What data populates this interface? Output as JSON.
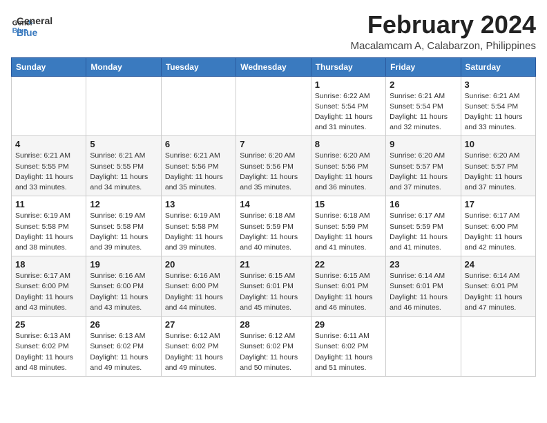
{
  "logo": {
    "line1": "General",
    "line2": "Blue"
  },
  "title": {
    "month_year": "February 2024",
    "location": "Macalamcam A, Calabarzon, Philippines"
  },
  "days_of_week": [
    "Sunday",
    "Monday",
    "Tuesday",
    "Wednesday",
    "Thursday",
    "Friday",
    "Saturday"
  ],
  "weeks": [
    [
      {
        "day": "",
        "info": ""
      },
      {
        "day": "",
        "info": ""
      },
      {
        "day": "",
        "info": ""
      },
      {
        "day": "",
        "info": ""
      },
      {
        "day": "1",
        "info": "Sunrise: 6:22 AM\nSunset: 5:54 PM\nDaylight: 11 hours\nand 31 minutes."
      },
      {
        "day": "2",
        "info": "Sunrise: 6:21 AM\nSunset: 5:54 PM\nDaylight: 11 hours\nand 32 minutes."
      },
      {
        "day": "3",
        "info": "Sunrise: 6:21 AM\nSunset: 5:54 PM\nDaylight: 11 hours\nand 33 minutes."
      }
    ],
    [
      {
        "day": "4",
        "info": "Sunrise: 6:21 AM\nSunset: 5:55 PM\nDaylight: 11 hours\nand 33 minutes."
      },
      {
        "day": "5",
        "info": "Sunrise: 6:21 AM\nSunset: 5:55 PM\nDaylight: 11 hours\nand 34 minutes."
      },
      {
        "day": "6",
        "info": "Sunrise: 6:21 AM\nSunset: 5:56 PM\nDaylight: 11 hours\nand 35 minutes."
      },
      {
        "day": "7",
        "info": "Sunrise: 6:20 AM\nSunset: 5:56 PM\nDaylight: 11 hours\nand 35 minutes."
      },
      {
        "day": "8",
        "info": "Sunrise: 6:20 AM\nSunset: 5:56 PM\nDaylight: 11 hours\nand 36 minutes."
      },
      {
        "day": "9",
        "info": "Sunrise: 6:20 AM\nSunset: 5:57 PM\nDaylight: 11 hours\nand 37 minutes."
      },
      {
        "day": "10",
        "info": "Sunrise: 6:20 AM\nSunset: 5:57 PM\nDaylight: 11 hours\nand 37 minutes."
      }
    ],
    [
      {
        "day": "11",
        "info": "Sunrise: 6:19 AM\nSunset: 5:58 PM\nDaylight: 11 hours\nand 38 minutes."
      },
      {
        "day": "12",
        "info": "Sunrise: 6:19 AM\nSunset: 5:58 PM\nDaylight: 11 hours\nand 39 minutes."
      },
      {
        "day": "13",
        "info": "Sunrise: 6:19 AM\nSunset: 5:58 PM\nDaylight: 11 hours\nand 39 minutes."
      },
      {
        "day": "14",
        "info": "Sunrise: 6:18 AM\nSunset: 5:59 PM\nDaylight: 11 hours\nand 40 minutes."
      },
      {
        "day": "15",
        "info": "Sunrise: 6:18 AM\nSunset: 5:59 PM\nDaylight: 11 hours\nand 41 minutes."
      },
      {
        "day": "16",
        "info": "Sunrise: 6:17 AM\nSunset: 5:59 PM\nDaylight: 11 hours\nand 41 minutes."
      },
      {
        "day": "17",
        "info": "Sunrise: 6:17 AM\nSunset: 6:00 PM\nDaylight: 11 hours\nand 42 minutes."
      }
    ],
    [
      {
        "day": "18",
        "info": "Sunrise: 6:17 AM\nSunset: 6:00 PM\nDaylight: 11 hours\nand 43 minutes."
      },
      {
        "day": "19",
        "info": "Sunrise: 6:16 AM\nSunset: 6:00 PM\nDaylight: 11 hours\nand 43 minutes."
      },
      {
        "day": "20",
        "info": "Sunrise: 6:16 AM\nSunset: 6:00 PM\nDaylight: 11 hours\nand 44 minutes."
      },
      {
        "day": "21",
        "info": "Sunrise: 6:15 AM\nSunset: 6:01 PM\nDaylight: 11 hours\nand 45 minutes."
      },
      {
        "day": "22",
        "info": "Sunrise: 6:15 AM\nSunset: 6:01 PM\nDaylight: 11 hours\nand 46 minutes."
      },
      {
        "day": "23",
        "info": "Sunrise: 6:14 AM\nSunset: 6:01 PM\nDaylight: 11 hours\nand 46 minutes."
      },
      {
        "day": "24",
        "info": "Sunrise: 6:14 AM\nSunset: 6:01 PM\nDaylight: 11 hours\nand 47 minutes."
      }
    ],
    [
      {
        "day": "25",
        "info": "Sunrise: 6:13 AM\nSunset: 6:02 PM\nDaylight: 11 hours\nand 48 minutes."
      },
      {
        "day": "26",
        "info": "Sunrise: 6:13 AM\nSunset: 6:02 PM\nDaylight: 11 hours\nand 49 minutes."
      },
      {
        "day": "27",
        "info": "Sunrise: 6:12 AM\nSunset: 6:02 PM\nDaylight: 11 hours\nand 49 minutes."
      },
      {
        "day": "28",
        "info": "Sunrise: 6:12 AM\nSunset: 6:02 PM\nDaylight: 11 hours\nand 50 minutes."
      },
      {
        "day": "29",
        "info": "Sunrise: 6:11 AM\nSunset: 6:02 PM\nDaylight: 11 hours\nand 51 minutes."
      },
      {
        "day": "",
        "info": ""
      },
      {
        "day": "",
        "info": ""
      }
    ]
  ]
}
